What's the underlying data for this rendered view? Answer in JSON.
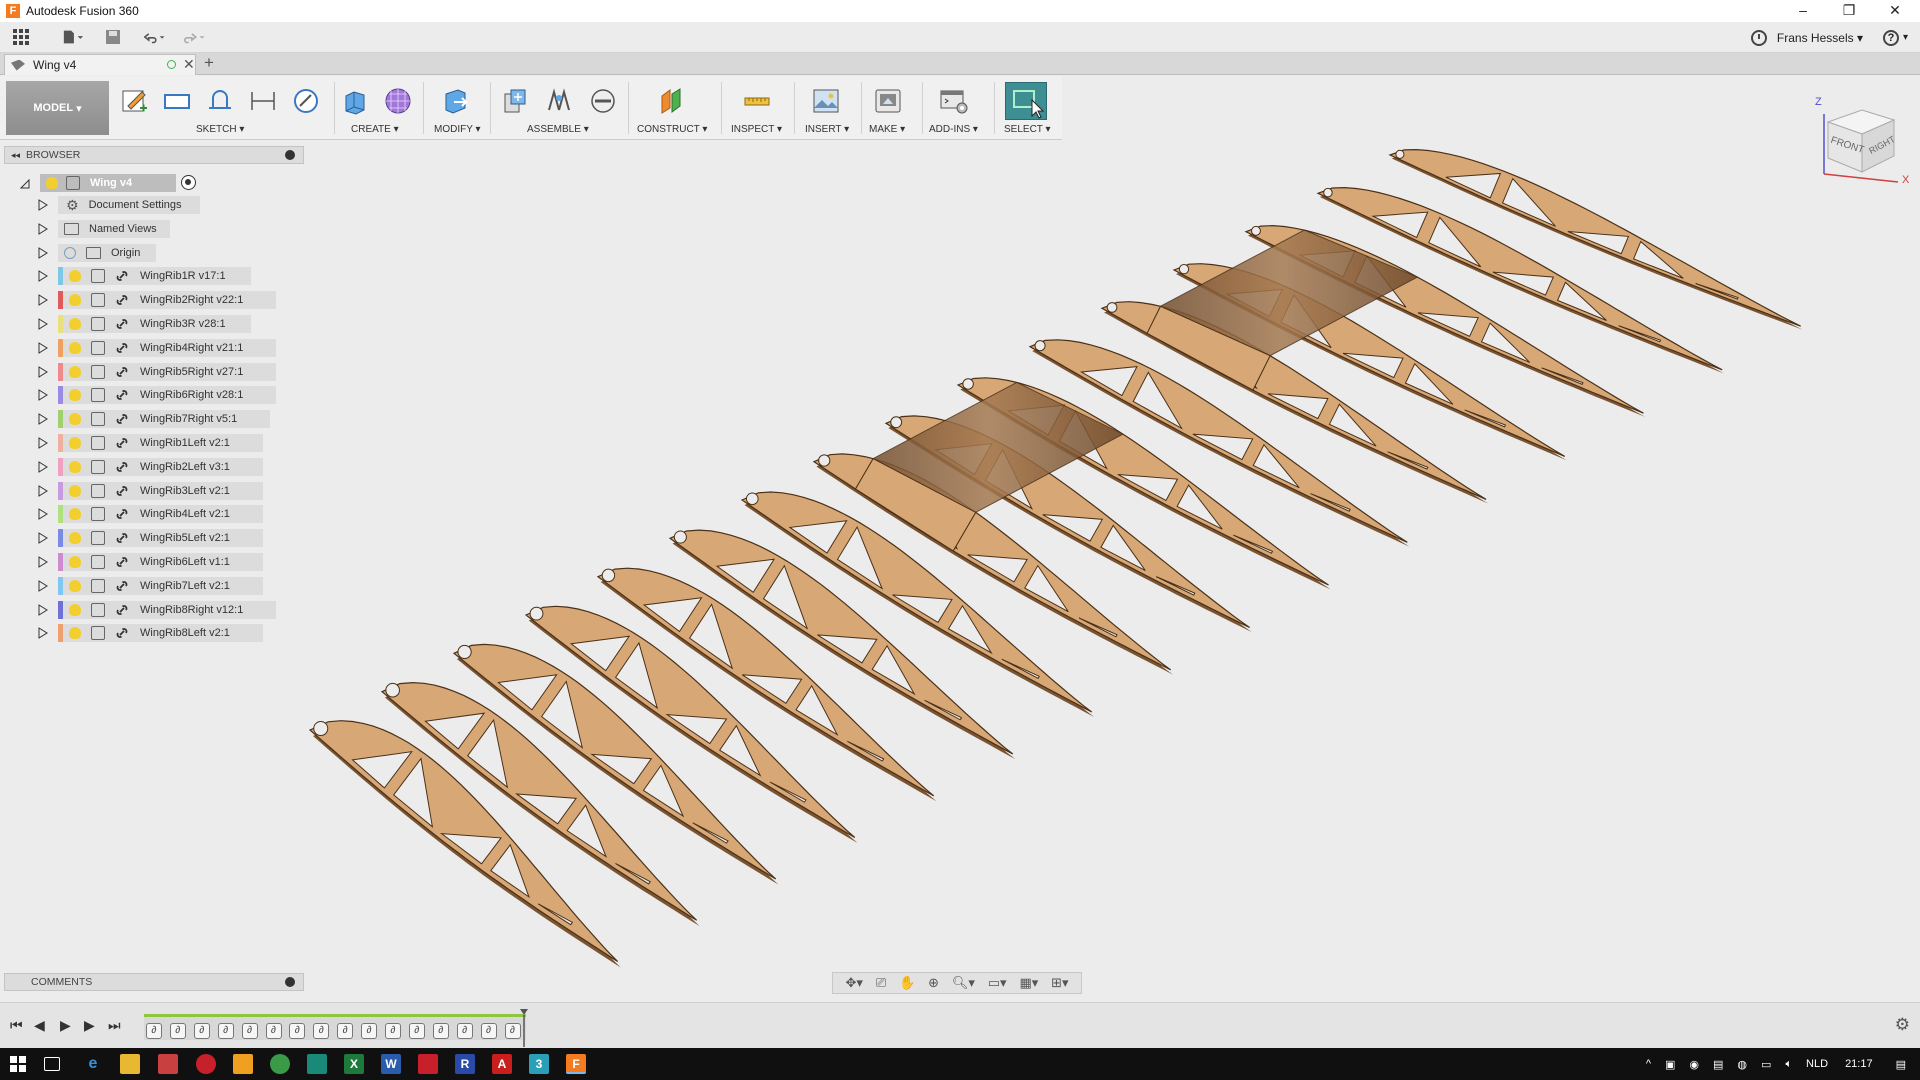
{
  "window": {
    "title": "Autodesk Fusion 360",
    "minimize": "–",
    "restore": "❐",
    "close": "✕"
  },
  "topbar": {
    "user_name": "Frans Hessels",
    "help_glyph": "?"
  },
  "document_tab": {
    "title": "Wing v4",
    "close": "✕",
    "new_tab": "+"
  },
  "ribbon": {
    "workspace": "MODEL",
    "groups": [
      {
        "label": "SKETCH"
      },
      {
        "label": "CREATE"
      },
      {
        "label": "MODIFY"
      },
      {
        "label": "ASSEMBLE"
      },
      {
        "label": "CONSTRUCT"
      },
      {
        "label": "INSPECT"
      },
      {
        "label": "INSERT"
      },
      {
        "label": "MAKE"
      },
      {
        "label": "ADD-INS"
      },
      {
        "label": "SELECT"
      }
    ]
  },
  "browser": {
    "title": "BROWSER",
    "root": "Wing v4",
    "items": [
      {
        "label": "Document Settings",
        "kind": "settings"
      },
      {
        "label": "Named Views",
        "kind": "folder"
      },
      {
        "label": "Origin",
        "kind": "origin"
      },
      {
        "label": "WingRib1R v17:1",
        "kind": "component",
        "color": "#7ec8e3"
      },
      {
        "label": "WingRib2Right v22:1",
        "kind": "component",
        "color": "#e05a5a"
      },
      {
        "label": "WingRib3R v28:1",
        "kind": "component",
        "color": "#e8e07a"
      },
      {
        "label": "WingRib4Right v21:1",
        "kind": "component",
        "color": "#f0a060"
      },
      {
        "label": "WingRib5Right v27:1",
        "kind": "component",
        "color": "#f08a8a"
      },
      {
        "label": "WingRib6Right v28:1",
        "kind": "component",
        "color": "#9a8ae6"
      },
      {
        "label": "WingRib7Right v5:1",
        "kind": "component",
        "color": "#a0d070"
      },
      {
        "label": "WingRib1Left v2:1",
        "kind": "component",
        "color": "#f0b0a0"
      },
      {
        "label": "WingRib2Left v3:1",
        "kind": "component",
        "color": "#f0a0c0"
      },
      {
        "label": "WingRib3Left v2:1",
        "kind": "component",
        "color": "#c89ae0"
      },
      {
        "label": "WingRib4Left v2:1",
        "kind": "component",
        "color": "#b0e080"
      },
      {
        "label": "WingRib5Left v2:1",
        "kind": "component",
        "color": "#7a8ae6"
      },
      {
        "label": "WingRib6Left v1:1",
        "kind": "component",
        "color": "#d08ad0"
      },
      {
        "label": "WingRib7Left v2:1",
        "kind": "component",
        "color": "#80c8f0"
      },
      {
        "label": "WingRib8Right v12:1",
        "kind": "component",
        "color": "#7070d8"
      },
      {
        "label": "WingRib8Left v2:1",
        "kind": "component",
        "color": "#f0a070"
      }
    ]
  },
  "viewcube": {
    "front": "FRONT",
    "right": "RIGHT",
    "axis_z": "Z",
    "axis_x": "X"
  },
  "comments": {
    "title": "COMMENTS"
  },
  "taskbar": {
    "language": "NLD",
    "time": "21:17"
  },
  "colors": {
    "wood": "#d7a876",
    "wood_dark": "#7b5431",
    "ribbon_active": "#3d8f94"
  }
}
